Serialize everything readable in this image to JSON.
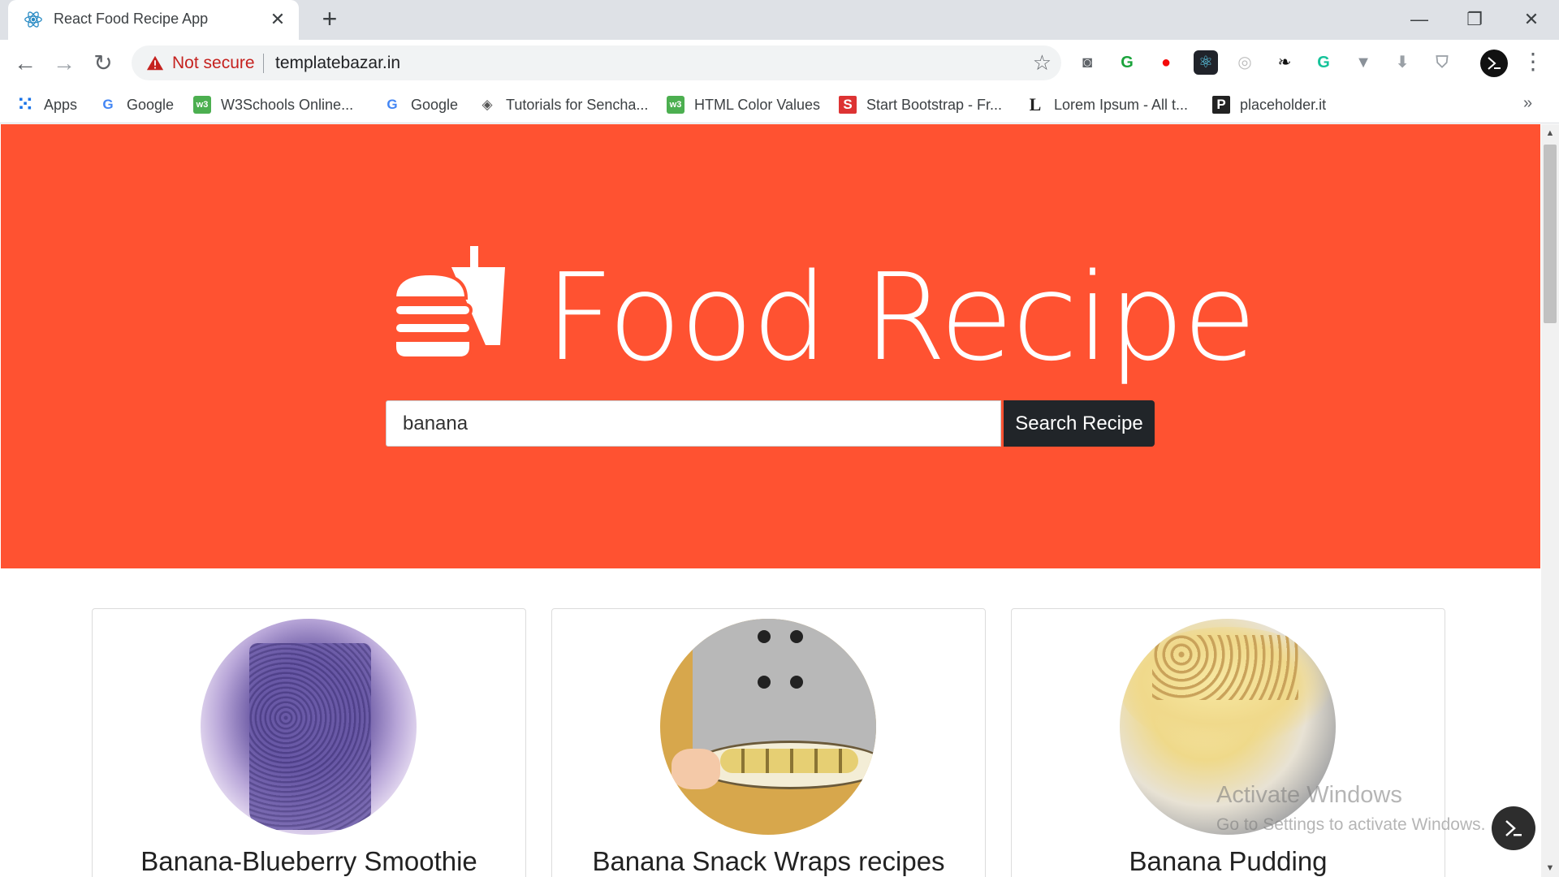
{
  "tab": {
    "title": "React Food Recipe App",
    "close": "✕",
    "new": "+"
  },
  "window": {
    "minimize": "—",
    "restore": "❐",
    "close": "✕"
  },
  "toolbar": {
    "back": "←",
    "forward": "→",
    "reload": "↻",
    "security_text": "Not secure",
    "url": "templatebazar.in",
    "star": "☆",
    "menu": "⋮",
    "extensions": [
      {
        "name": "camera-extension-icon",
        "glyph": "◙",
        "color": "#5f6368",
        "bg": "transparent"
      },
      {
        "name": "grammarly-go-extension-icon",
        "glyph": "G",
        "color": "#1aa33b",
        "bg": "transparent"
      },
      {
        "name": "adblock-extension-icon",
        "glyph": "●",
        "color": "#f40a0a",
        "bg": "transparent"
      },
      {
        "name": "react-devtools-extension-icon",
        "glyph": "⚛",
        "color": "#61dafb",
        "bg": "#20232a"
      },
      {
        "name": "color-picker-extension-icon",
        "glyph": "◎",
        "color": "#bdbdbd",
        "bg": "transparent"
      },
      {
        "name": "bird-extension-icon",
        "glyph": "❧",
        "color": "#111111",
        "bg": "transparent"
      },
      {
        "name": "grammarly-extension-icon",
        "glyph": "G",
        "color": "#15c39a",
        "bg": "transparent"
      },
      {
        "name": "vue-devtools-extension-icon",
        "glyph": "▼",
        "color": "#8a9199",
        "bg": "transparent"
      },
      {
        "name": "download-extension-icon",
        "glyph": "⬇",
        "color": "#9aa0a6",
        "bg": "transparent"
      },
      {
        "name": "shield-extension-icon",
        "glyph": "⛉",
        "color": "#9aa0a6",
        "bg": "transparent"
      }
    ]
  },
  "bookmarks": {
    "items": [
      {
        "label": "Apps",
        "icon": "apps-grid-icon",
        "glyph": "⁙",
        "color": "#1a73e8"
      },
      {
        "label": "Google",
        "icon": "google-icon",
        "glyph": "G",
        "color": "#4285f4"
      },
      {
        "label": "W3Schools Online...",
        "icon": "w3schools-icon",
        "glyph": "w3",
        "color": "#4caf50"
      },
      {
        "label": "Google",
        "icon": "google-icon",
        "glyph": "G",
        "color": "#4285f4"
      },
      {
        "label": "Tutorials for Sencha...",
        "icon": "sencha-icon",
        "glyph": "◈",
        "color": "#555555"
      },
      {
        "label": "HTML Color Values",
        "icon": "w3schools-icon",
        "glyph": "w3",
        "color": "#4caf50"
      },
      {
        "label": "Start Bootstrap - Fr...",
        "icon": "startbootstrap-icon",
        "glyph": "S",
        "color": "#dd3333"
      },
      {
        "label": "Lorem Ipsum - All t...",
        "icon": "lorem-ipsum-icon",
        "glyph": "L",
        "color": "#222222"
      },
      {
        "label": "placeholder.it",
        "icon": "placeholder-icon",
        "glyph": "P",
        "color": "#222222"
      }
    ],
    "more": "»"
  },
  "hero": {
    "brand": "Food Recipe",
    "search_value": "banana",
    "search_button": "Search Recipe",
    "color": "#ff5231"
  },
  "recipes": [
    {
      "title": "Banana-Blueberry Smoothie"
    },
    {
      "title": "Banana Snack Wraps recipes"
    },
    {
      "title": "Banana Pudding"
    }
  ],
  "watermark": {
    "line1": "Activate Windows",
    "line2": "Go to Settings to activate Windows."
  },
  "scrollbar": {
    "up": "▲",
    "down": "▼"
  }
}
